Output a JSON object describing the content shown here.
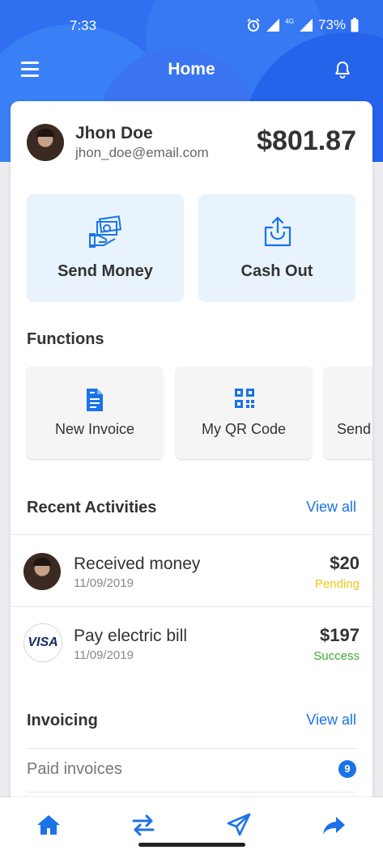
{
  "status_bar": {
    "time": "7:33",
    "network": "4G",
    "battery": "73%"
  },
  "header": {
    "title": "Home"
  },
  "user": {
    "name": "Jhon Doe",
    "email": "jhon_doe@email.com",
    "balance": "$801.87"
  },
  "quick_actions": [
    {
      "label": "Send Money",
      "icon": "money-hand-icon"
    },
    {
      "label": "Cash Out",
      "icon": "cash-out-box-icon"
    }
  ],
  "functions": {
    "title": "Functions",
    "items": [
      {
        "label": "New Invoice",
        "icon": "document-icon"
      },
      {
        "label": "My QR Code",
        "icon": "qr-code-icon"
      },
      {
        "label": "Send"
      }
    ]
  },
  "recent": {
    "title": "Recent Activities",
    "view_all": "View all",
    "items": [
      {
        "title": "Received money",
        "date": "11/09/2019",
        "amount": "$20",
        "status": "Pending"
      },
      {
        "title": "Pay electric bill",
        "date": "11/09/2019",
        "amount": "$197",
        "status": "Success",
        "logo": "VISA"
      }
    ]
  },
  "invoicing": {
    "title": "Invoicing",
    "view_all": "View all",
    "paid_label": "Paid invoices",
    "paid_count": "9"
  },
  "colors": {
    "primary": "#1a73e8",
    "header_blue": "#2f6ff0",
    "pending": "#f4c514",
    "success": "#3aaa35",
    "tile_bg": "#e9f3fd"
  },
  "bottom_nav": [
    "home-icon",
    "transfer-icon",
    "send-icon",
    "share-icon"
  ]
}
